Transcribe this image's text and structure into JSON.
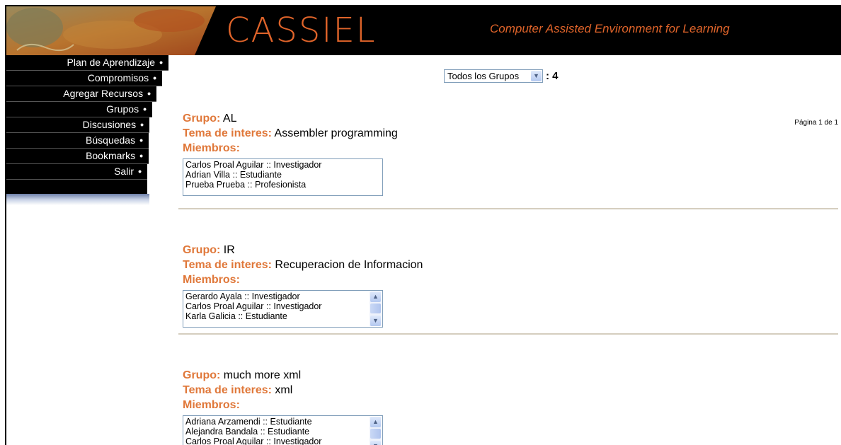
{
  "header": {
    "title": "CASSIEL",
    "subtitle": "Computer Assisted Environment for Learning"
  },
  "sidebar": {
    "items": [
      {
        "label": "Plan de Aprendizaje"
      },
      {
        "label": "Compromisos"
      },
      {
        "label": "Agregar Recursos"
      },
      {
        "label": "Grupos"
      },
      {
        "label": "Discusiones"
      },
      {
        "label": "Búsquedas"
      },
      {
        "label": "Bookmarks"
      },
      {
        "label": "Salir"
      }
    ],
    "bullet": "•"
  },
  "filter": {
    "selected": "Todos los Grupos",
    "count_text": ": 4"
  },
  "pagination": "Página 1 de 1",
  "labels": {
    "group": "Grupo:",
    "topic": "Tema de interes:",
    "members": "Miembros:"
  },
  "groups": [
    {
      "name": "AL",
      "topic": "Assembler programming",
      "members": [
        "Carlos Proal Aguilar :: Investigador",
        "Adrian Villa :: Estudiante",
        "Prueba Prueba :: Profesionista"
      ]
    },
    {
      "name": "IR",
      "topic": "Recuperacion de Informacion",
      "members": [
        "Gerardo Ayala :: Investigador",
        "Carlos Proal Aguilar :: Investigador",
        "Karla Galicia :: Estudiante"
      ]
    },
    {
      "name": "much more xml",
      "topic": "xml",
      "members": [
        "Adriana Arzamendi :: Estudiante",
        "Alejandra Bandala :: Estudiante",
        "Carlos Proal Aguilar :: Investigador"
      ]
    }
  ],
  "icons": {
    "dropdown": "chevron-down-icon",
    "scroll_up": "chevron-up-icon",
    "scroll_down": "chevron-down-icon"
  },
  "colors": {
    "brand": "#e0642a",
    "label": "#e0783a",
    "nav_bg": "#000000",
    "divider": "#d5cebf"
  }
}
